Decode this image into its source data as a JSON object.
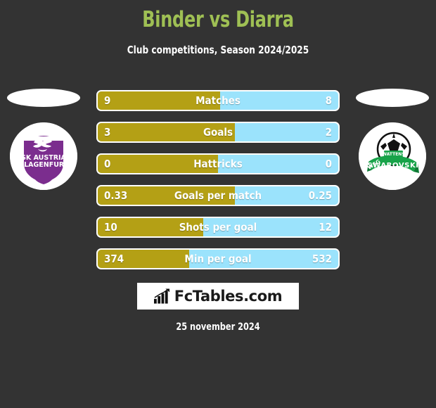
{
  "header": {
    "title": "Binder vs Diarra",
    "subtitle": "Club competitions, Season 2024/2025"
  },
  "colors": {
    "background": "#333333",
    "title_green": "#9FC054",
    "home_bar_gold": "#B4A015",
    "away_bar_blue": "#9BE3FC",
    "text_white": "#FFFFFF",
    "home_club_purple": "#7B2D8E",
    "away_club_green": "#18A349"
  },
  "clubs": {
    "home": {
      "name_line1": "SK AUSTRIA",
      "name_line2": "KLAGENFURT",
      "icon": "club-crest-icon"
    },
    "away": {
      "name_top": "WSG",
      "name_main": "SWAROVSKI",
      "name_inner": "WATTENS",
      "icon": "club-crest-icon"
    }
  },
  "chart_data": {
    "type": "bar",
    "title": "Binder vs Diarra",
    "subtitle": "Club competitions, Season 2024/2025",
    "orientation": "horizontal-diverging",
    "categories": [
      "Matches",
      "Goals",
      "Hattricks",
      "Goals per match",
      "Shots per goal",
      "Min per goal"
    ],
    "series": [
      {
        "name": "Binder",
        "color": "#B4A015",
        "values": [
          "9",
          "3",
          "0",
          "0.33",
          "10",
          "374"
        ]
      },
      {
        "name": "Diarra",
        "color": "#9BE3FC",
        "values": [
          "8",
          "2",
          "0",
          "0.25",
          "12",
          "532"
        ]
      }
    ],
    "rows": [
      {
        "label": "Matches",
        "left": "9",
        "right": "8",
        "left_pct": 51
      },
      {
        "label": "Goals",
        "left": "3",
        "right": "2",
        "left_pct": 57
      },
      {
        "label": "Hattricks",
        "left": "0",
        "right": "0",
        "left_pct": 50
      },
      {
        "label": "Goals per match",
        "left": "0.33",
        "right": "0.25",
        "left_pct": 57
      },
      {
        "label": "Shots per goal",
        "left": "10",
        "right": "12",
        "left_pct": 44
      },
      {
        "label": "Min per goal",
        "left": "374",
        "right": "532",
        "left_pct": 38
      }
    ],
    "grid": false,
    "legend": "none"
  },
  "footer": {
    "brand": "FcTables.com",
    "brand_icon": "bar-chart-icon",
    "date": "25 november 2024"
  }
}
